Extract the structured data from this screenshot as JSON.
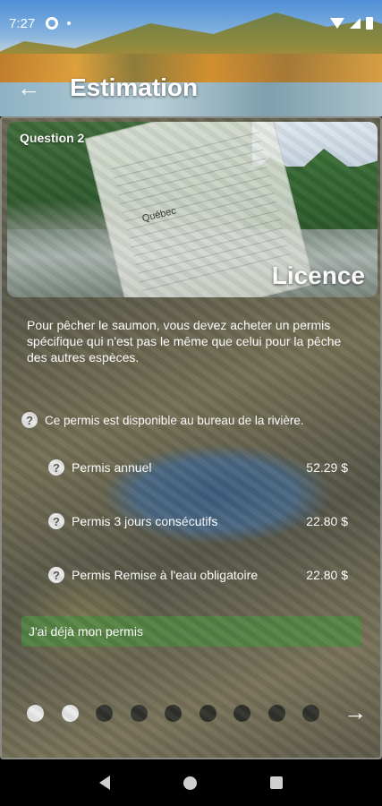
{
  "status_bar": {
    "time": "7:27"
  },
  "app_bar": {
    "title": "Estimation",
    "back_icon": "arrow-left-icon"
  },
  "question": {
    "label": "Question 2",
    "hero_title": "Licence",
    "hero_paper_text": "Québec",
    "description": "Pour pêcher le saumon, vous devez acheter un permis spécifique qui n'est pas le même que celui pour la pêche des autres espèces.",
    "info": "Ce permis est disponible au bureau de la rivière."
  },
  "permits": [
    {
      "label": "Permis annuel",
      "price": "52.29 $"
    },
    {
      "label": "Permis 3 jours consécutifs",
      "price": "22.80 $"
    },
    {
      "label": "Permis Remise à l'eau obligatoire",
      "price": "22.80 $"
    }
  ],
  "owned_button": {
    "label": "J'ai  déjà mon permis"
  },
  "pager": {
    "total": 9,
    "current": 2,
    "next_icon": "arrow-right-icon"
  },
  "colors": {
    "owned_button": "#4c8c40",
    "dot_active": "#e9e9e9",
    "dot_inactive": "#31312c"
  }
}
